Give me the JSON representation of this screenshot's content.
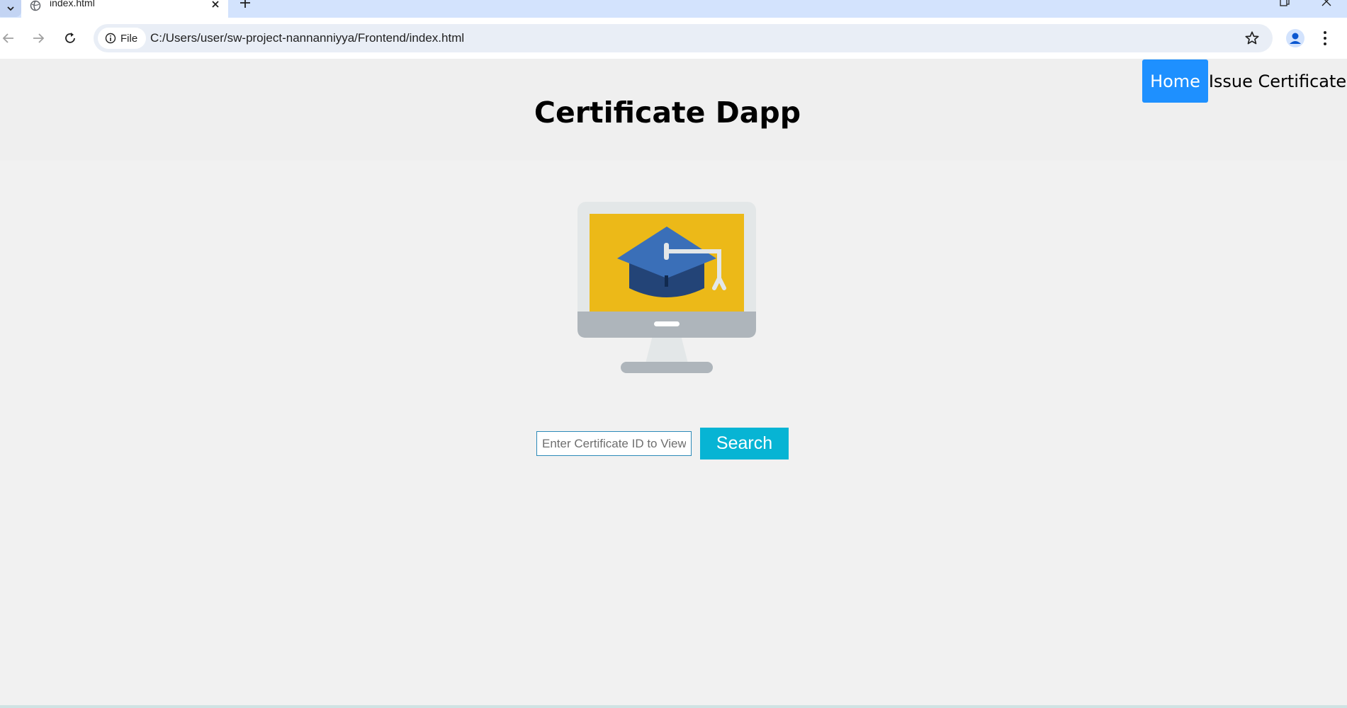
{
  "browser": {
    "tab_title": "index.html",
    "site_chip_label": "File",
    "url": "C:/Users/user/sw-project-nannanniyya/Frontend/index.html"
  },
  "page": {
    "title": "Certificate Dapp",
    "nav": {
      "home_label": "Home",
      "issue_label": "Issue Certificate"
    },
    "search": {
      "placeholder": "Enter Certificate ID to View",
      "button_label": "Search"
    }
  },
  "colors": {
    "nav_home_bg": "#1e90ff",
    "search_button_bg": "#07b4d4",
    "screen_yellow": "#ecb918",
    "cap_blue": "#3a6fb8",
    "cap_dark": "#234477"
  },
  "icons": [
    "tab-list-icon",
    "globe-icon",
    "close-icon",
    "plus-icon",
    "restore-icon",
    "back-arrow-icon",
    "forward-arrow-icon",
    "reload-icon",
    "info-icon",
    "star-icon",
    "profile-icon",
    "kebab-menu-icon"
  ]
}
